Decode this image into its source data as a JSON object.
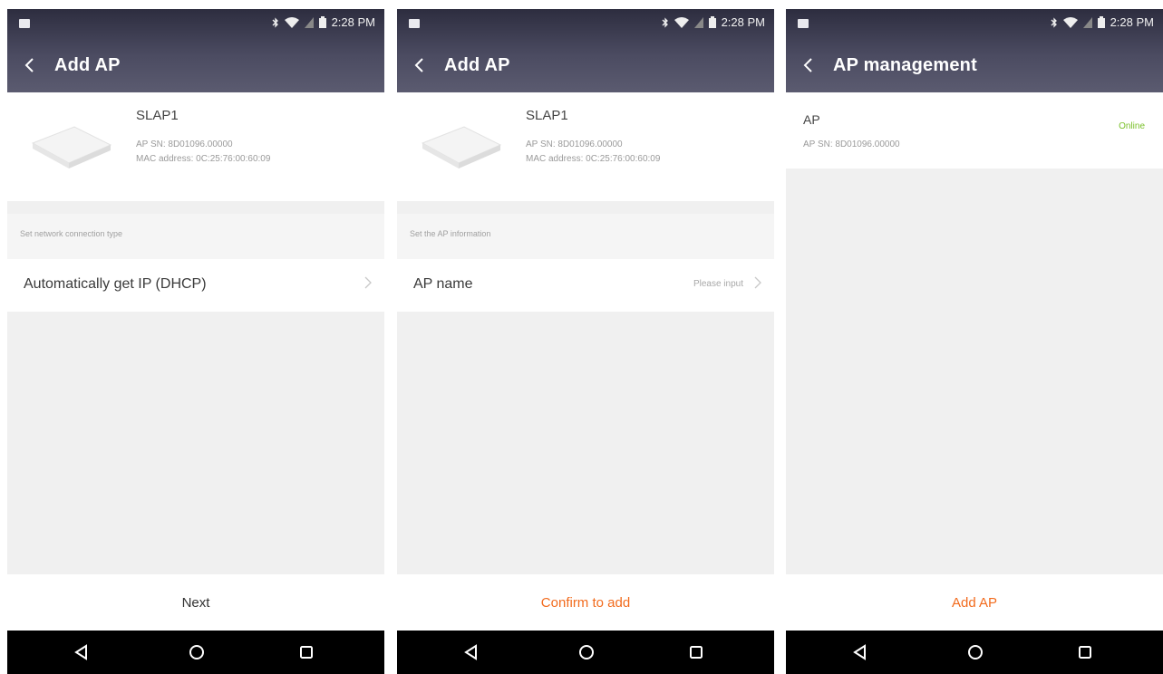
{
  "colors": {
    "appbar_dark": "#2d2d3f",
    "appbar_light": "#5b5b70",
    "accent_orange": "#f26b1d",
    "status_green": "#7ac02a",
    "background": "#f0f0f0"
  },
  "status_bar": {
    "time": "2:28 PM",
    "icons": [
      "bluetooth-icon",
      "wifi-icon",
      "signal-icon",
      "battery-icon"
    ]
  },
  "screens": [
    {
      "title": "Add AP",
      "device": {
        "name": "SLAP1",
        "sn": "AP SN: 8D01096.00000",
        "mac": "MAC address: 0C:25:76:00:60:09"
      },
      "section_label": "Set network connection type",
      "row": {
        "label": "Automatically get IP (DHCP)",
        "value": ""
      },
      "action": "Next"
    },
    {
      "title": "Add AP",
      "device": {
        "name": "SLAP1",
        "sn": "AP SN: 8D01096.00000",
        "mac": "MAC address: 0C:25:76:00:60:09"
      },
      "section_label": "Set the AP information",
      "row": {
        "label": "AP name",
        "value": "Please input"
      },
      "action": "Confirm to add"
    },
    {
      "title": "AP management",
      "ap_list": [
        {
          "name": "AP",
          "sn": "AP SN: 8D01096.00000",
          "status": "Online"
        }
      ],
      "action": "Add AP"
    }
  ]
}
